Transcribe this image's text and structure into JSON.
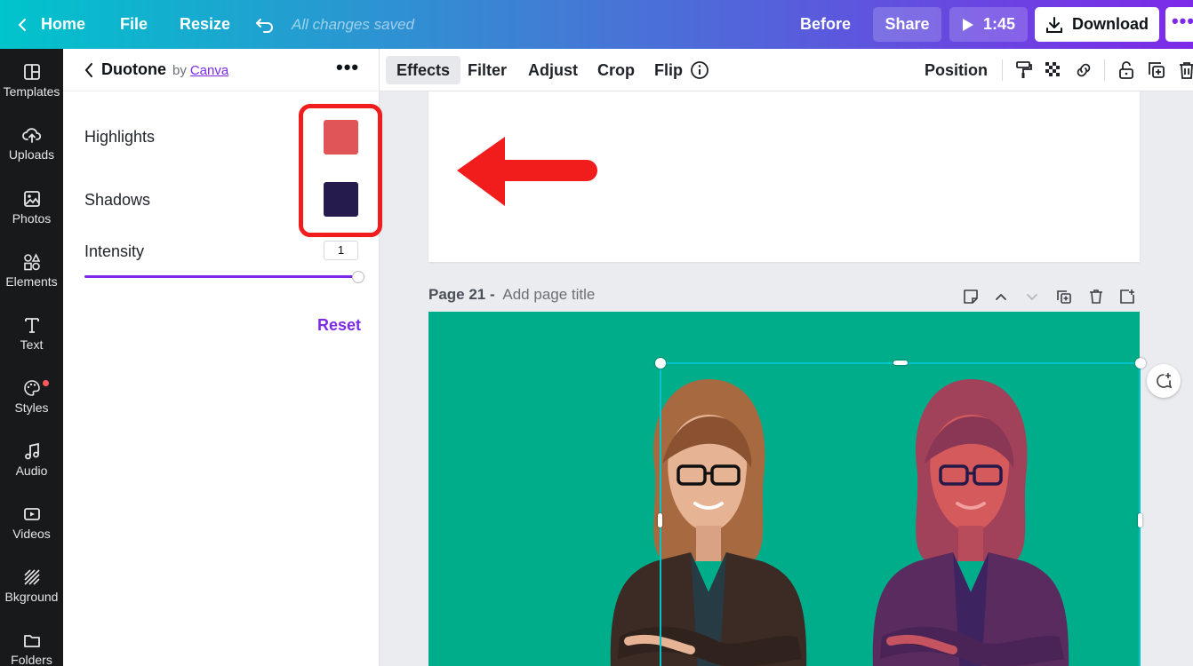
{
  "topbar": {
    "home_label": "Home",
    "file_label": "File",
    "resize_label": "Resize",
    "saved_status": "All changes saved",
    "before_label": "Before",
    "share_label": "Share",
    "play_time": "1:45",
    "download_label": "Download",
    "more_label": "•••"
  },
  "rail": {
    "items": [
      {
        "label": "Templates",
        "icon": "templates-icon"
      },
      {
        "label": "Uploads",
        "icon": "upload-cloud-icon"
      },
      {
        "label": "Photos",
        "icon": "photo-icon"
      },
      {
        "label": "Elements",
        "icon": "shapes-icon"
      },
      {
        "label": "Text",
        "icon": "text-t-icon"
      },
      {
        "label": "Styles",
        "icon": "palette-icon"
      },
      {
        "label": "Audio",
        "icon": "music-note-icon"
      },
      {
        "label": "Videos",
        "icon": "video-icon"
      },
      {
        "label": "Bkground",
        "icon": "background-hatch-icon"
      },
      {
        "label": "Folders",
        "icon": "folder-icon"
      }
    ]
  },
  "panel": {
    "title": "Duotone",
    "by_label": "by",
    "by_link": "Canva",
    "more_label": "•••",
    "highlights_label": "Highlights",
    "highlights_color": "#e05555",
    "shadows_label": "Shadows",
    "shadows_color": "#261b4d",
    "intensity_label": "Intensity",
    "intensity_value": "1",
    "intensity_level": 1.0,
    "reset_label": "Reset"
  },
  "toolbar": {
    "effects_label": "Effects",
    "filter_label": "Filter",
    "adjust_label": "Adjust",
    "crop_label": "Crop",
    "flip_label": "Flip",
    "position_label": "Position"
  },
  "canvas": {
    "page_label": "Page 21 -",
    "page_title_placeholder": "Add page title",
    "background_color": "#00ad8a",
    "annotation_color": "#f11c1c"
  }
}
